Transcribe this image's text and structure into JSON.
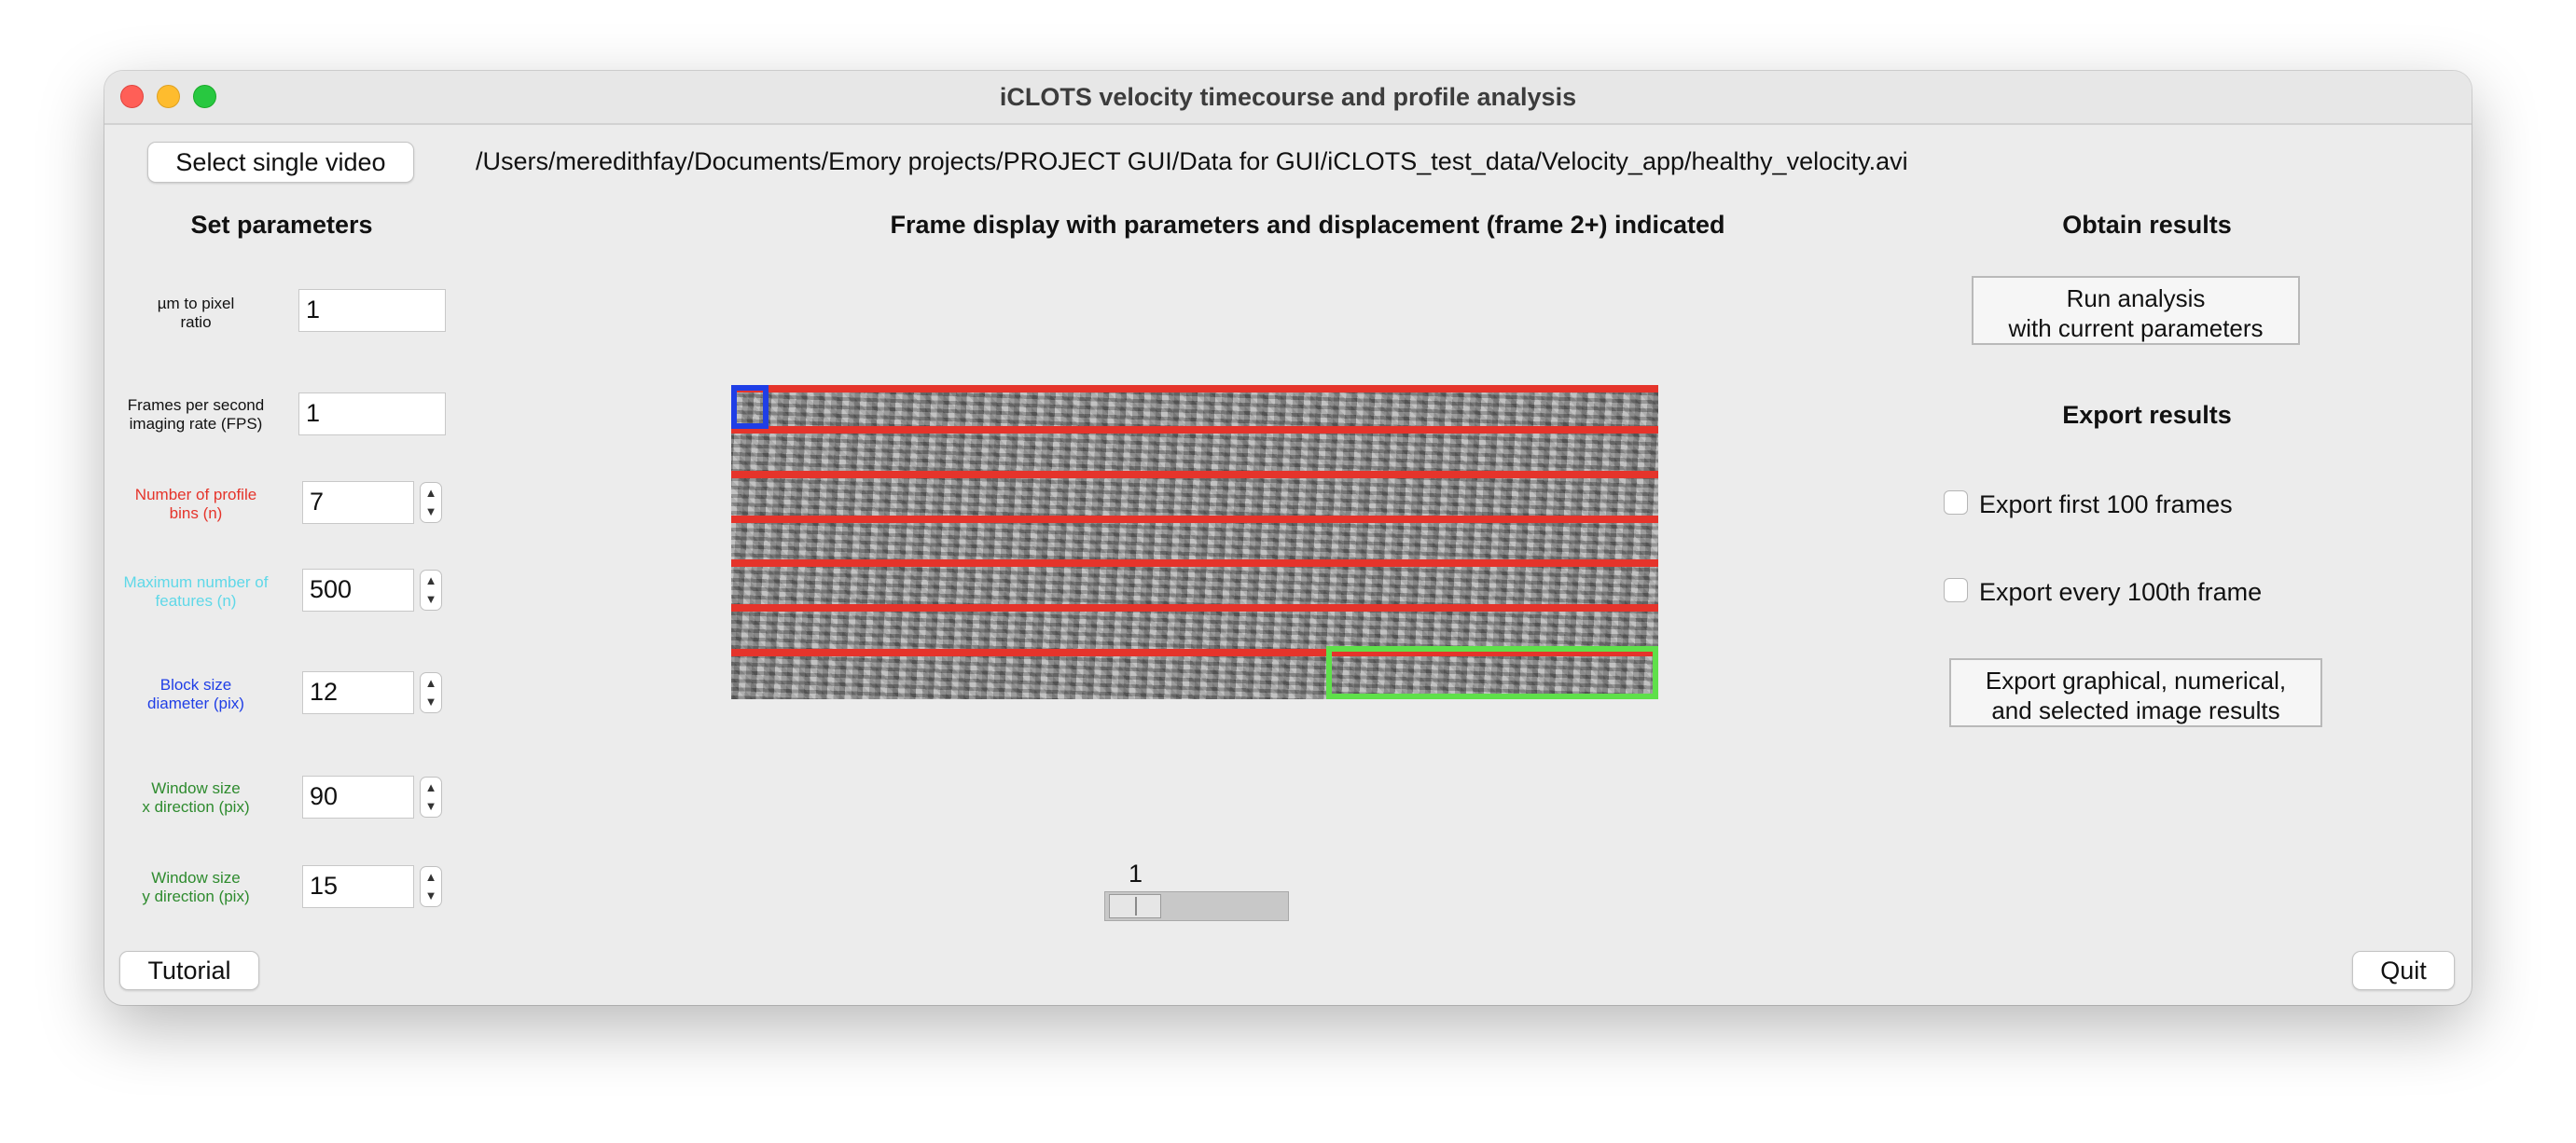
{
  "window": {
    "title": "iCLOTS velocity timecourse and profile analysis"
  },
  "file": {
    "select_label": "Select single video",
    "path": "/Users/meredithfay/Documents/Emory projects/PROJECT GUI/Data for GUI/iCLOTS_test_data/Velocity_app/healthy_velocity.avi"
  },
  "params": {
    "heading": "Set parameters",
    "um_pixel": {
      "label": "µm to pixel\nratio",
      "value": "1",
      "color": "#111111"
    },
    "fps": {
      "label": "Frames per second\nimaging rate (FPS)",
      "value": "1",
      "color": "#111111"
    },
    "bins": {
      "label": "Number of profile\nbins (n)",
      "value": "7",
      "color": "#e5342b"
    },
    "max_features": {
      "label": "Maximum number of\nfeatures (n)",
      "value": "500",
      "color": "#5fd8e8"
    },
    "block_size": {
      "label": "Block size\ndiameter (pix)",
      "value": "12",
      "color": "#1f3ee6"
    },
    "window_x": {
      "label": "Window size\nx direction (pix)",
      "value": "90",
      "color": "#2e8b2e"
    },
    "window_y": {
      "label": "Window size\ny direction (pix)",
      "value": "15",
      "color": "#2e8b2e"
    }
  },
  "display": {
    "heading": "Frame display with parameters and displacement (frame 2+) indicated",
    "profile_bins": 7,
    "frame_slider": {
      "value": "1",
      "min": 1
    }
  },
  "results": {
    "heading": "Obtain results",
    "run_label": "Run analysis\nwith current parameters"
  },
  "export": {
    "heading": "Export results",
    "first100_label": "Export first 100 frames",
    "first100_checked": false,
    "every100_label": "Export every 100th frame",
    "every100_checked": false,
    "export_label": "Export graphical, numerical,\nand selected image results"
  },
  "footer": {
    "tutorial_label": "Tutorial",
    "quit_label": "Quit"
  }
}
